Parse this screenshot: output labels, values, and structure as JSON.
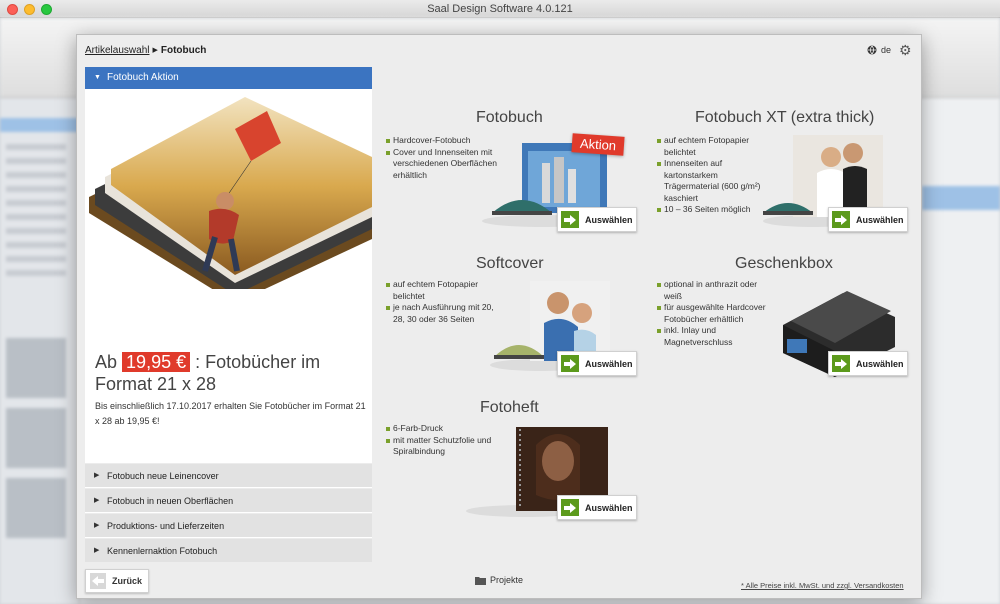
{
  "window": {
    "title": "Saal Design Software 4.0.121"
  },
  "dialog": {
    "breadcrumb": {
      "parent": "Artikelauswahl",
      "current": "Fotobuch"
    },
    "language": "de",
    "promo": {
      "header": "Fotobuch Aktion",
      "title_prefix": "Ab",
      "price": "19,95 €",
      "title_suffix": ": Fotobücher im Format 21 x 28",
      "text": "Bis einschließlich 17.10.2017 erhalten Sie Fotobücher im Format 21 x 28 ab 19,95 €!"
    },
    "accordion": [
      {
        "label": "Fotobuch neue Leinencover"
      },
      {
        "label": "Fotobuch in neuen Oberflächen"
      },
      {
        "label": "Produktions- und Lieferzeiten"
      },
      {
        "label": "Kennenlernaktion Fotobuch"
      }
    ],
    "products": [
      {
        "title": "Fotobuch",
        "badge": "Aktion",
        "features": [
          "Hardcover-Fotobuch",
          "Cover und Innenseiten mit verschiedenen Oberflächen erhältlich"
        ],
        "button": "Auswählen"
      },
      {
        "title": "Fotobuch XT (extra thick)",
        "features": [
          "auf echtem Fotopapier belichtet",
          "Innenseiten auf kartonstarkem Trägermaterial (600 g/m²) kaschiert",
          "10 – 36 Seiten möglich"
        ],
        "button": "Auswählen"
      },
      {
        "title": "Softcover",
        "features": [
          "auf echtem Fotopapier belichtet",
          "je nach Ausführung mit 20, 28, 30 oder 36 Seiten"
        ],
        "button": "Auswählen"
      },
      {
        "title": "Geschenkbox",
        "features": [
          "optional in anthrazit oder weiß",
          "für ausgewählte Hardcover Fotobücher erhältlich",
          "inkl. Inlay und Magnetverschluss"
        ],
        "button": "Auswählen"
      },
      {
        "title": "Fotoheft",
        "features": [
          "6-Farb-Druck",
          "mit matter Schutzfolie und Spiralbindung"
        ],
        "button": "Auswählen"
      }
    ],
    "footer": {
      "back": "Zurück",
      "projects": "Projekte",
      "note": "* Alle Preise inkl. MwSt. und zzgl. Versandkosten"
    }
  },
  "colors": {
    "accent_blue": "#3b74c1",
    "action_green": "#5c9a1c",
    "promo_red": "#e03a2b"
  }
}
